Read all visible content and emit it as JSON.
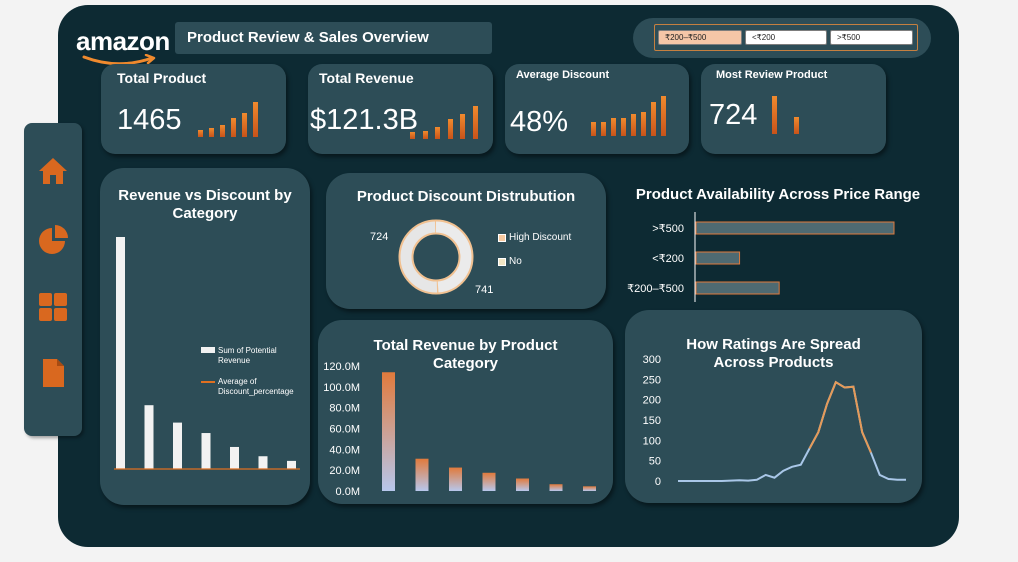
{
  "brand": {
    "logo_text": "amazon"
  },
  "header": {
    "title": "Product Review & Sales Overview"
  },
  "slicer": {
    "options": [
      "₹200–₹500",
      "<₹200",
      ">₹500"
    ],
    "selected": "₹200–₹500"
  },
  "sidebar": {
    "items": [
      "home",
      "pie-chart",
      "grid",
      "document"
    ]
  },
  "colors": {
    "background": "#0d2a33",
    "card": "#2d4d57",
    "accent": "#d9681f",
    "bar_light": "#f2f2f2",
    "line": "#a9c7e8"
  },
  "kpis": [
    {
      "title": "Total Product",
      "value": "1465",
      "spark": [
        0.2,
        0.25,
        0.35,
        0.55,
        0.7,
        1.0
      ]
    },
    {
      "title": "Total Revenue",
      "value": "$121.3B",
      "spark": [
        0.2,
        0.25,
        0.35,
        0.6,
        0.75,
        1.0
      ]
    },
    {
      "title": "Average Discount",
      "value": "48%",
      "spark": [
        0.35,
        0.35,
        0.45,
        0.45,
        0.55,
        0.6,
        0.85,
        1.0
      ]
    },
    {
      "title": "Most Review Product",
      "value": "724",
      "spark": [
        1.0,
        0.45
      ]
    }
  ],
  "panels": {
    "rev_disc": {
      "title": "Revenue vs Discount by Category",
      "legend": [
        "Sum of Potential Revenue",
        "Average of Discount_percentage"
      ]
    },
    "donut": {
      "title": "Product Discount Distrubution"
    },
    "avail": {
      "title": "Product Availability Across Price Range"
    },
    "rev_cat": {
      "title": "Total Revenue by Product Category"
    },
    "ratings": {
      "title": "How Ratings Are Spread Across Products"
    }
  },
  "chart_data": [
    {
      "id": "revenue_vs_discount",
      "type": "bar",
      "title": "Revenue vs Discount by Category",
      "series": [
        {
          "name": "Sum of Potential Revenue",
          "values": [
            100,
            27.5,
            20,
            15.5,
            9.5,
            5.5,
            3.5
          ]
        },
        {
          "name": "Average of Discount_percentage",
          "values": [
            0,
            0,
            0,
            0,
            0,
            0,
            0
          ]
        }
      ],
      "legend": "right"
    },
    {
      "id": "discount_distribution",
      "type": "pie",
      "title": "Product Discount Distrubution",
      "categories": [
        "High Discount",
        "No"
      ],
      "values": [
        724,
        741
      ],
      "legend": "right"
    },
    {
      "id": "availability",
      "type": "bar",
      "title": "Product Availability Across Price Range",
      "categories": [
        ">₹500",
        "<₹200",
        "₹200–₹500"
      ],
      "values": [
        100,
        22,
        42
      ]
    },
    {
      "id": "revenue_by_category",
      "type": "bar",
      "title": "Total Revenue by Product Category",
      "categories": [
        "",
        "",
        "",
        "",
        "",
        "",
        ""
      ],
      "values": [
        114000000,
        31000000,
        22500000,
        17500000,
        12000000,
        6500000,
        4500000
      ],
      "ylim": [
        0,
        120000000
      ],
      "yticks": [
        "0.0M",
        "20.0M",
        "40.0M",
        "60.0M",
        "80.0M",
        "100.0M",
        "120.0M"
      ]
    },
    {
      "id": "ratings_spread",
      "type": "line",
      "title": "How Ratings Are Spread Across Products",
      "values": [
        0,
        0,
        0,
        0,
        0,
        0,
        1,
        2,
        1,
        3,
        15,
        8,
        25,
        35,
        40,
        80,
        120,
        190,
        243,
        230,
        232,
        120,
        70,
        15,
        5,
        3,
        3
      ],
      "ylim": [
        0,
        300
      ],
      "yticks": [
        "0",
        "50",
        "100",
        "150",
        "200",
        "250",
        "300"
      ]
    }
  ]
}
